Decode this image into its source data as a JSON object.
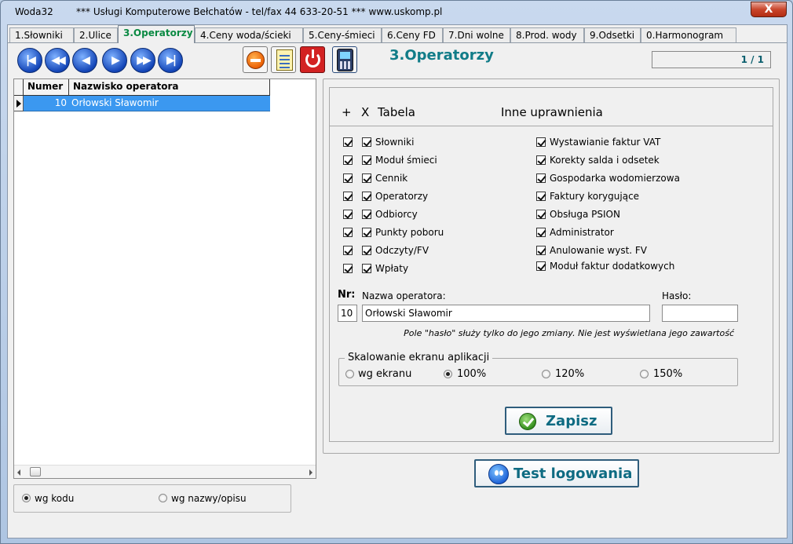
{
  "window": {
    "app_name": "Woda32",
    "title": "*** Usługi Komputerowe Bełchatów - tel/fax  44 633-20-51  ***  www.uskomp.pl",
    "close_label": "X"
  },
  "tabs": [
    {
      "label": "1.Słowniki",
      "active": false
    },
    {
      "label": "2.Ulice",
      "active": false
    },
    {
      "label": "3.Operatorzy",
      "active": true
    },
    {
      "label": "4.Ceny woda/ścieki",
      "active": false
    },
    {
      "label": "5.Ceny-śmieci",
      "active": false
    },
    {
      "label": "6.Ceny FD",
      "active": false
    },
    {
      "label": "7.Dni wolne",
      "active": false
    },
    {
      "label": "8.Prod. wody",
      "active": false
    },
    {
      "label": "9.Odsetki",
      "active": false
    },
    {
      "label": "0.Harmonogram",
      "active": false
    }
  ],
  "navigation": {
    "first": "first-record-icon",
    "prev_page": "previous-page-icon",
    "prev": "previous-record-icon",
    "next": "next-record-icon",
    "next_page": "next-page-icon",
    "last": "last-record-icon"
  },
  "toolbar_icons": [
    "delete-icon",
    "notes-icon",
    "power-icon",
    "psion-device-icon"
  ],
  "page_heading": "3.Operatorzy",
  "pager": "1 / 1",
  "grid": {
    "columns": [
      "Numer",
      "Nazwisko operatora"
    ],
    "rows": [
      {
        "numer": "10",
        "nazwisko": "Orłowski Sławomir",
        "selected": true
      }
    ]
  },
  "sort_options": [
    {
      "label": "wg kodu",
      "selected": true
    },
    {
      "label": "wg nazwy/opisu",
      "selected": false
    }
  ],
  "permissions": {
    "header_plus": "+",
    "header_x": "X",
    "header_table": "Tabela",
    "header_other": "Inne uprawnienia",
    "tables": [
      {
        "label": "Słowniki",
        "plus": true,
        "x": true
      },
      {
        "label": "Moduł śmieci",
        "plus": true,
        "x": true
      },
      {
        "label": "Cennik",
        "plus": true,
        "x": true
      },
      {
        "label": "Operatorzy",
        "plus": true,
        "x": true
      },
      {
        "label": "Odbiorcy",
        "plus": true,
        "x": true
      },
      {
        "label": "Punkty poboru",
        "plus": true,
        "x": true
      },
      {
        "label": "Odczyty/FV",
        "plus": true,
        "x": true
      },
      {
        "label": "Wpłaty",
        "plus": true,
        "x": true
      }
    ],
    "other": [
      {
        "label": "Wystawianie faktur VAT",
        "checked": true
      },
      {
        "label": "Korekty salda i odsetek",
        "checked": true
      },
      {
        "label": "Gospodarka wodomierzowa",
        "checked": true
      },
      {
        "label": "Faktury korygujące",
        "checked": true
      },
      {
        "label": "Obsługa PSION",
        "checked": true
      },
      {
        "label": "Administrator",
        "checked": true
      },
      {
        "label": "Anulowanie wyst. FV",
        "checked": true
      },
      {
        "label": "Moduł faktur dodatkowych",
        "checked": true
      }
    ]
  },
  "form": {
    "nr_label": "Nr:",
    "nr_value": "10",
    "name_label": "Nazwa operatora:",
    "name_value": "Orłowski Sławomir",
    "password_label": "Hasło:",
    "password_value": "",
    "note": "Pole \"hasło\" służy tylko do jego zmiany. Nie jest wyświetlana jego zawartość"
  },
  "scaling": {
    "title": "Skalowanie ekranu aplikacji",
    "options": [
      {
        "label": "wg ekranu",
        "selected": false
      },
      {
        "label": "100%",
        "selected": true
      },
      {
        "label": "120%",
        "selected": false
      },
      {
        "label": "150%",
        "selected": false
      }
    ]
  },
  "buttons": {
    "save": "Zapisz",
    "test_login": "Test logowania"
  },
  "colors": {
    "heading": "#117c88",
    "active_tab": "#0b8a43",
    "selection": "#3b98f0"
  }
}
